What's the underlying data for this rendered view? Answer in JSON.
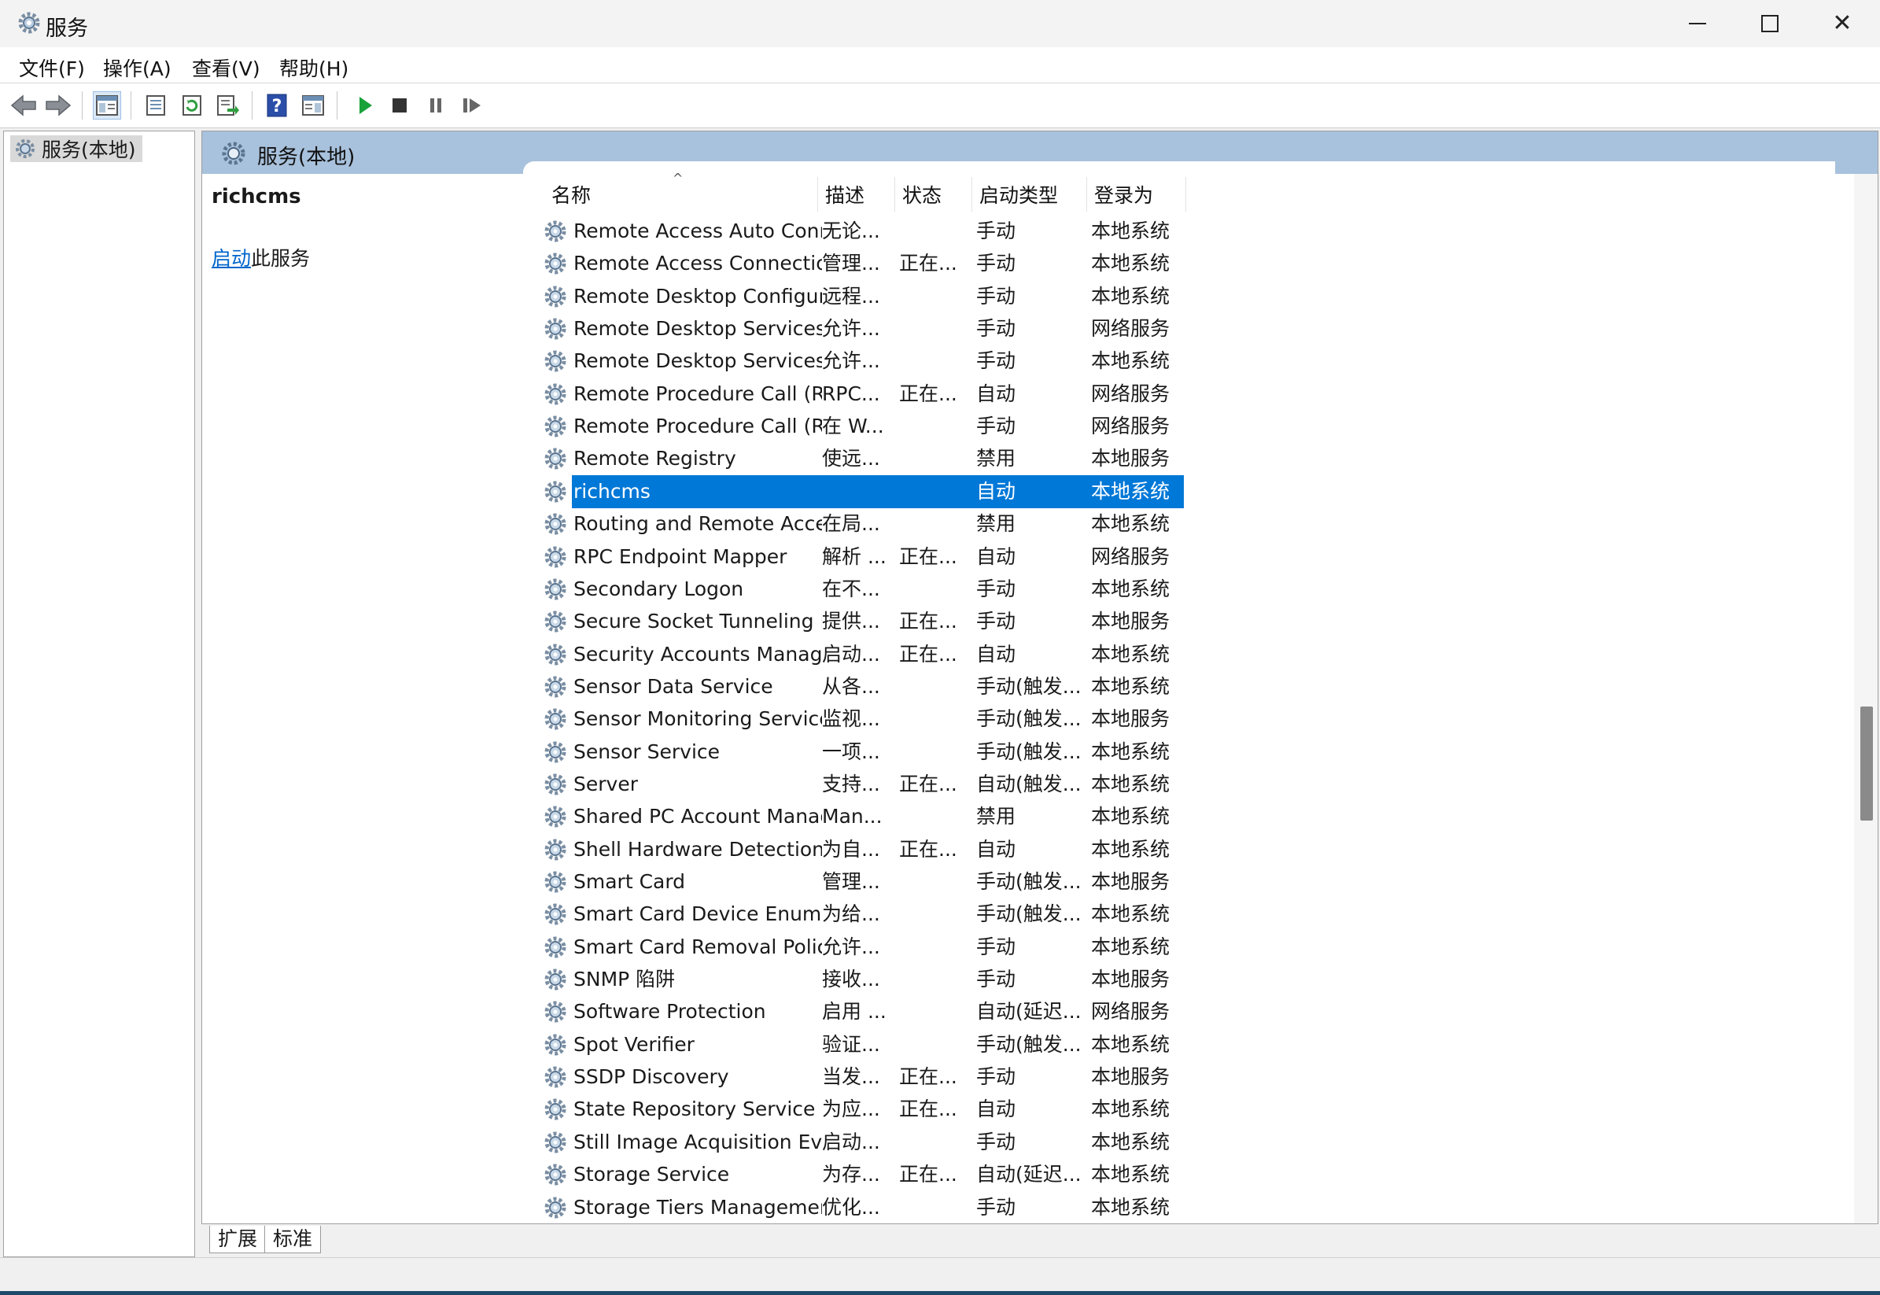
{
  "window": {
    "title": "服务",
    "icon": "gear-icon"
  },
  "menu": [
    "文件(F)",
    "操作(A)",
    "查看(V)",
    "帮助(H)"
  ],
  "toolbar": {
    "buttons": [
      "back-arrow-icon",
      "forward-arrow-icon",
      "show-hide-console-tree-icon",
      "properties-icon",
      "refresh-icon",
      "export-list-icon",
      "help-icon",
      "show-hide-action-pane-icon",
      "start-service-icon",
      "stop-service-icon",
      "pause-service-icon",
      "restart-service-icon"
    ]
  },
  "tree": {
    "root_label": "服务(本地)"
  },
  "pane": {
    "header": "服务(本地)",
    "selected_service": "richcms",
    "action_link": "启动",
    "action_suffix": "此服务"
  },
  "columns": {
    "name": "名称",
    "desc": "描述",
    "status": "状态",
    "startup": "启动类型",
    "logon": "登录为"
  },
  "services": [
    {
      "name": "Remote Access Auto Conn...",
      "desc": "无论...",
      "status": "",
      "startup": "手动",
      "logon": "本地系统"
    },
    {
      "name": "Remote Access Connectio...",
      "desc": "管理...",
      "status": "正在...",
      "startup": "手动",
      "logon": "本地系统"
    },
    {
      "name": "Remote Desktop Configur...",
      "desc": "远程...",
      "status": "",
      "startup": "手动",
      "logon": "本地系统"
    },
    {
      "name": "Remote Desktop Services",
      "desc": "允许...",
      "status": "",
      "startup": "手动",
      "logon": "网络服务"
    },
    {
      "name": "Remote Desktop Services ...",
      "desc": "允许...",
      "status": "",
      "startup": "手动",
      "logon": "本地系统"
    },
    {
      "name": "Remote Procedure Call (R...",
      "desc": "RPC...",
      "status": "正在...",
      "startup": "自动",
      "logon": "网络服务"
    },
    {
      "name": "Remote Procedure Call (R...",
      "desc": "在 W...",
      "status": "",
      "startup": "手动",
      "logon": "网络服务"
    },
    {
      "name": "Remote Registry",
      "desc": "使远...",
      "status": "",
      "startup": "禁用",
      "logon": "本地服务"
    },
    {
      "name": "richcms",
      "desc": "",
      "status": "",
      "startup": "自动",
      "logon": "本地系统",
      "selected": true
    },
    {
      "name": "Routing and Remote Access",
      "desc": "在局...",
      "status": "",
      "startup": "禁用",
      "logon": "本地系统"
    },
    {
      "name": "RPC Endpoint Mapper",
      "desc": "解析 ...",
      "status": "正在...",
      "startup": "自动",
      "logon": "网络服务"
    },
    {
      "name": "Secondary Logon",
      "desc": "在不...",
      "status": "",
      "startup": "手动",
      "logon": "本地系统"
    },
    {
      "name": "Secure Socket Tunneling P...",
      "desc": "提供...",
      "status": "正在...",
      "startup": "手动",
      "logon": "本地服务"
    },
    {
      "name": "Security Accounts Manager",
      "desc": "启动...",
      "status": "正在...",
      "startup": "自动",
      "logon": "本地系统"
    },
    {
      "name": "Sensor Data Service",
      "desc": "从各...",
      "status": "",
      "startup": "手动(触发...",
      "logon": "本地系统"
    },
    {
      "name": "Sensor Monitoring Service",
      "desc": "监视...",
      "status": "",
      "startup": "手动(触发...",
      "logon": "本地服务"
    },
    {
      "name": "Sensor Service",
      "desc": "一项...",
      "status": "",
      "startup": "手动(触发...",
      "logon": "本地系统"
    },
    {
      "name": "Server",
      "desc": "支持...",
      "status": "正在...",
      "startup": "自动(触发...",
      "logon": "本地系统"
    },
    {
      "name": "Shared PC Account Manager",
      "desc": "Man...",
      "status": "",
      "startup": "禁用",
      "logon": "本地系统"
    },
    {
      "name": "Shell Hardware Detection",
      "desc": "为自...",
      "status": "正在...",
      "startup": "自动",
      "logon": "本地系统"
    },
    {
      "name": "Smart Card",
      "desc": "管理...",
      "status": "",
      "startup": "手动(触发...",
      "logon": "本地服务"
    },
    {
      "name": "Smart Card Device Enumer...",
      "desc": "为给...",
      "status": "",
      "startup": "手动(触发...",
      "logon": "本地系统"
    },
    {
      "name": "Smart Card Removal Policy",
      "desc": "允许...",
      "status": "",
      "startup": "手动",
      "logon": "本地系统"
    },
    {
      "name": "SNMP 陷阱",
      "desc": "接收...",
      "status": "",
      "startup": "手动",
      "logon": "本地服务"
    },
    {
      "name": "Software Protection",
      "desc": "启用 ...",
      "status": "",
      "startup": "自动(延迟...",
      "logon": "网络服务"
    },
    {
      "name": "Spot Verifier",
      "desc": "验证...",
      "status": "",
      "startup": "手动(触发...",
      "logon": "本地系统"
    },
    {
      "name": "SSDP Discovery",
      "desc": "当发...",
      "status": "正在...",
      "startup": "手动",
      "logon": "本地服务"
    },
    {
      "name": "State Repository Service",
      "desc": "为应...",
      "status": "正在...",
      "startup": "自动",
      "logon": "本地系统"
    },
    {
      "name": "Still Image Acquisition Eve...",
      "desc": "启动...",
      "status": "",
      "startup": "手动",
      "logon": "本地系统"
    },
    {
      "name": "Storage Service",
      "desc": "为存...",
      "status": "正在...",
      "startup": "自动(延迟...",
      "logon": "本地系统"
    },
    {
      "name": "Storage Tiers Management",
      "desc": "优化...",
      "status": "",
      "startup": "手动",
      "logon": "本地系统"
    }
  ],
  "tabs": [
    "扩展",
    "标准"
  ]
}
